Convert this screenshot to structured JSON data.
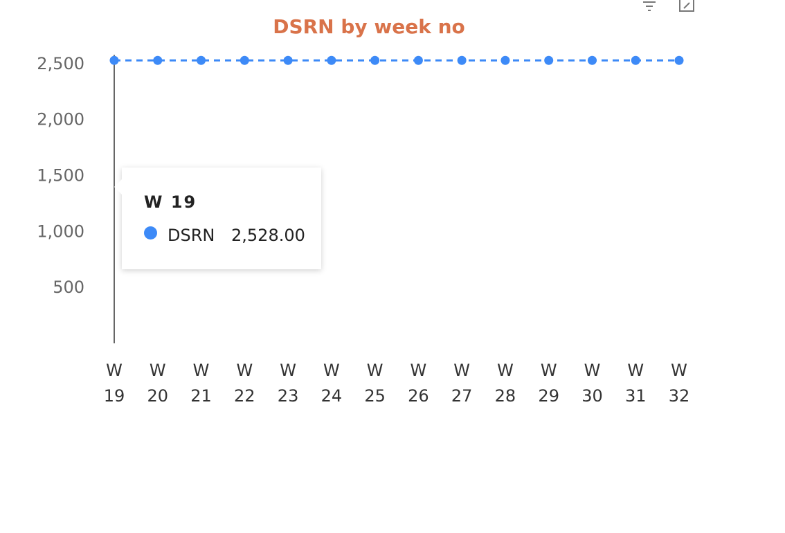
{
  "chart_data": {
    "type": "line",
    "title": "DSRN by week no",
    "xlabel": "",
    "ylabel": "",
    "categories": [
      "W 19",
      "W 20",
      "W 21",
      "W 22",
      "W 23",
      "W 24",
      "W 25",
      "W 26",
      "W 27",
      "W 28",
      "W 29",
      "W 30",
      "W 31",
      "W 32"
    ],
    "category_lines": [
      [
        "W",
        "19"
      ],
      [
        "W",
        "20"
      ],
      [
        "W",
        "21"
      ],
      [
        "W",
        "22"
      ],
      [
        "W",
        "23"
      ],
      [
        "W",
        "24"
      ],
      [
        "W",
        "25"
      ],
      [
        "W",
        "26"
      ],
      [
        "W",
        "27"
      ],
      [
        "W",
        "28"
      ],
      [
        "W",
        "29"
      ],
      [
        "W",
        "30"
      ],
      [
        "W",
        "31"
      ],
      [
        "W",
        "32"
      ]
    ],
    "series": [
      {
        "name": "DSRN",
        "values": [
          2528,
          2528,
          2528,
          2528,
          2528,
          2528,
          2528,
          2528,
          2528,
          2528,
          2528,
          2528,
          2528,
          2528
        ],
        "line_style": "dashed"
      }
    ],
    "y_ticks": [
      500,
      1000,
      1500,
      2000,
      2500
    ],
    "y_tick_labels": [
      "500",
      "1,000",
      "1,500",
      "2,000",
      "2,500"
    ],
    "ylim": [
      0,
      2600
    ],
    "grid": false,
    "legend": "none",
    "colors": {
      "series": "#3d8af7",
      "title": "#d9734a"
    }
  },
  "tooltip": {
    "title": "W 19",
    "series_name": "DSRN",
    "value": "2,528.00"
  },
  "header_icons": [
    "filter-icon",
    "focus-mode-icon"
  ]
}
